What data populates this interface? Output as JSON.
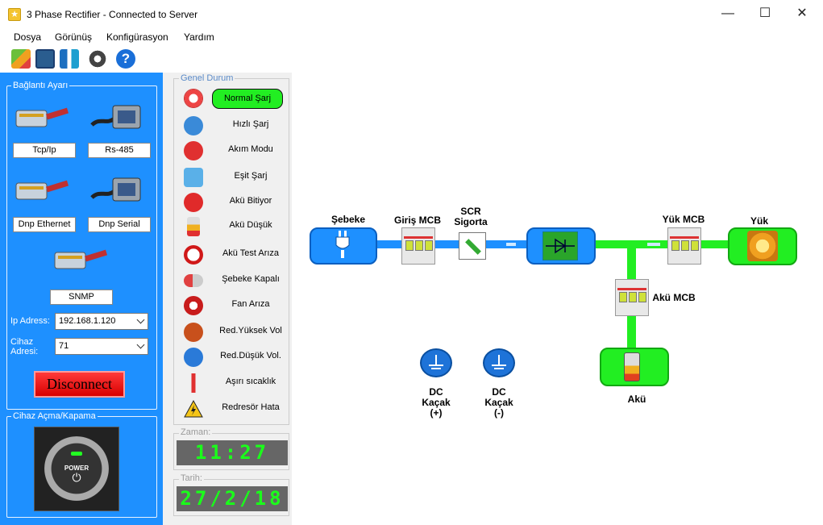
{
  "window": {
    "title": "3 Phase Rectifier - Connected to Server",
    "minimize": "—",
    "maximize": "☐",
    "close": "✕"
  },
  "menu": {
    "items": [
      "Dosya",
      "Görünüş",
      "Konfigürasyon",
      "Yardım"
    ]
  },
  "toolbar": {
    "icons": [
      "chart-icon",
      "window-icon",
      "network-icon",
      "gear-icon",
      "help-icon"
    ],
    "help_glyph": "?"
  },
  "connection": {
    "group_title": "Bağlantı Ayarı",
    "tcp_label": "Tcp/Ip",
    "rs485_label": "Rs-485",
    "dnp_ethernet_label": "Dnp Ethernet",
    "dnp_serial_label": "Dnp Serial",
    "snmp_label": "SNMP",
    "ip_label": "Ip Adress:",
    "ip_value": "192.168.1.120",
    "device_label_1": "Cihaz",
    "device_label_2": "Adresi:",
    "device_value": "71",
    "disconnect_label": "Disconnect"
  },
  "power": {
    "group_title": "Cihaz Açma/Kapama",
    "label": "POWER",
    "glyph": "⏻"
  },
  "status": {
    "group_title": "Genel Durum",
    "items": [
      "Normal Şarj",
      "Hızlı Şarj",
      "Akım Modu",
      "Eşit Şarj",
      "Akü Bitiyor",
      "Akü Düşük",
      "Akü Test Arıza",
      "Şebeke Kapalı",
      "Fan Arıza",
      "Red.Yüksek Vol",
      "Red.Düşük Vol.",
      "Aşırı sıcaklık",
      "Redresör Hata"
    ],
    "active_color": "#22ee22"
  },
  "time": {
    "title": "Zaman:",
    "value": "11:27"
  },
  "date": {
    "title": "Tarih:",
    "value": "27/2/18"
  },
  "diagram": {
    "sebeke": "Şebeke",
    "giris_mcb": "Giriş MCB",
    "scr_1": "SCR",
    "scr_2": "Sigorta",
    "yuk_mcb": "Yük MCB",
    "yuk": "Yük",
    "aku_mcb": "Akü MCB",
    "aku": "Akü",
    "dc_pos_1": "DC",
    "dc_pos_2": "Kaçak",
    "dc_pos_3": "(+)",
    "dc_neg_1": "DC",
    "dc_neg_2": "Kaçak",
    "dc_neg_3": "(-)",
    "line_blue": "#1e90ff",
    "line_green": "#22ee22"
  }
}
